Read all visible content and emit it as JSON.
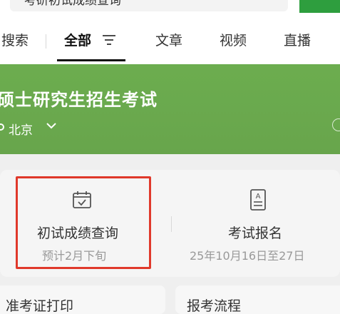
{
  "search": {
    "query": "考研初试成绩查询"
  },
  "tabs": [
    {
      "label": "搜索"
    },
    {
      "label": "全部"
    },
    {
      "label": "文章"
    },
    {
      "label": "视频"
    },
    {
      "label": "直播"
    }
  ],
  "banner": {
    "title": "硕士研究生招生考试",
    "location": "北京"
  },
  "cards": [
    {
      "title": "初试成绩查询",
      "subtitle": "预计2月下旬"
    },
    {
      "title": "考试报名",
      "subtitle": "25年10月16日至27日"
    }
  ],
  "bottom_cards": [
    {
      "label": "准考证打印"
    },
    {
      "label": "报考流程"
    }
  ],
  "colors": {
    "accent_green": "#6aa84f",
    "highlight_red": "#e0392b"
  }
}
